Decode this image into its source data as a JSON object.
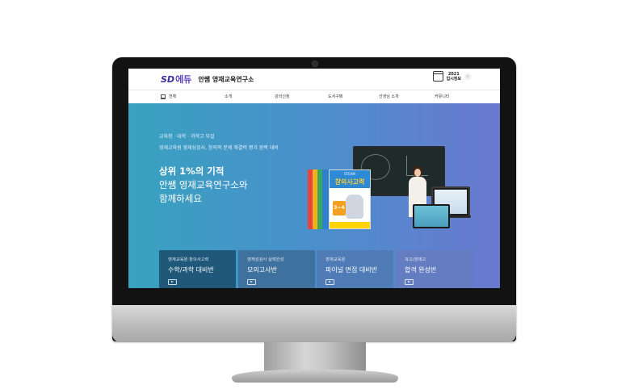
{
  "header": {
    "logo_sd": "SD",
    "logo_edu": "에듀",
    "brand": "안쌤 영재교육연구소",
    "date_year": "2021",
    "date_label": "입시정보"
  },
  "nav": {
    "all": "전체",
    "items": [
      "소개",
      "강의신청",
      "도서구매",
      "선생님 소개",
      "커뮤니티"
    ]
  },
  "hero": {
    "line1": "교육청 · 대학 · 과학고 부설",
    "line2": "영재교육원 영재성검사, 창의적 문제 해결력 평가 완벽 대비",
    "headline": "상위 1%의 기적",
    "sub1": "안쌤 영재교육연구소와",
    "sub2": "함께하세요"
  },
  "book": {
    "series": "STEAM",
    "title": "창의사고력",
    "grade": "3~4"
  },
  "cards": [
    {
      "sub": "영재교육원 창의사고력",
      "title": "수학/과학 대비반",
      "color": "#1f5879"
    },
    {
      "sub": "영재성검사 실력완성",
      "title": "모의고사반",
      "color": "#3f719e"
    },
    {
      "sub": "영재교육원",
      "title": "파이널 면접 대비반",
      "color": "#4f7bb6"
    },
    {
      "sub": "과고/영재고",
      "title": "합격 완성반",
      "color": "#647dc0"
    }
  ]
}
